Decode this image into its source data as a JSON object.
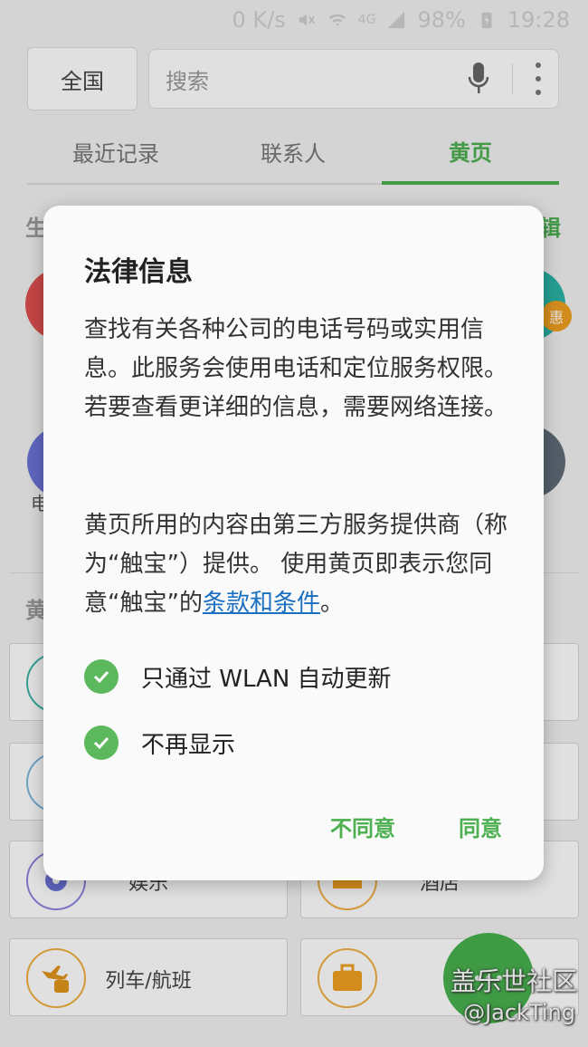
{
  "status_bar": {
    "speed": "0 K/s",
    "network": "4G",
    "battery": "98%",
    "time": "19:28"
  },
  "search_row": {
    "region_label": "全国",
    "search_placeholder": "搜索"
  },
  "tabs": [
    {
      "label": "最近记录",
      "active": false
    },
    {
      "label": "联系人",
      "active": false
    },
    {
      "label": "黄页",
      "active": true
    }
  ],
  "background": {
    "section1_partial": "生",
    "section1_edit_partial": "辑",
    "badge": "惠",
    "section2_partial": "黄",
    "label_partial_left": "电",
    "cards": [
      {
        "label": "娱乐",
        "icon": "movie-ticket-icon"
      },
      {
        "label": "酒店",
        "icon": "hotel-bed-icon"
      },
      {
        "label": "列车/航班",
        "icon": "plane-train-icon"
      },
      {
        "label": "",
        "icon": "briefcase-icon"
      }
    ]
  },
  "dialog": {
    "title": "法律信息",
    "paragraph1": "查找有关各种公司的电话号码或实用信息。此服务会使用电话和定位服务权限。若要查看更详细的信息，需要网络连接。",
    "paragraph2_prefix": "黄页所用的内容由第三方服务提供商（称为“触宝”）提供。 使用黄页即表示您同意“触宝”的",
    "paragraph2_link": "条款和条件",
    "paragraph2_suffix": "。",
    "checkboxes": [
      {
        "label": "只通过 WLAN 自动更新",
        "checked": true
      },
      {
        "label": "不再显示",
        "checked": true
      }
    ],
    "disagree_label": "不同意",
    "agree_label": "同意"
  },
  "watermark": {
    "line1": "盖乐世社区",
    "line2": "@JackTing"
  },
  "colors": {
    "accent": "#4caf50",
    "link": "#1a6fc0",
    "check": "#5cb85c"
  }
}
